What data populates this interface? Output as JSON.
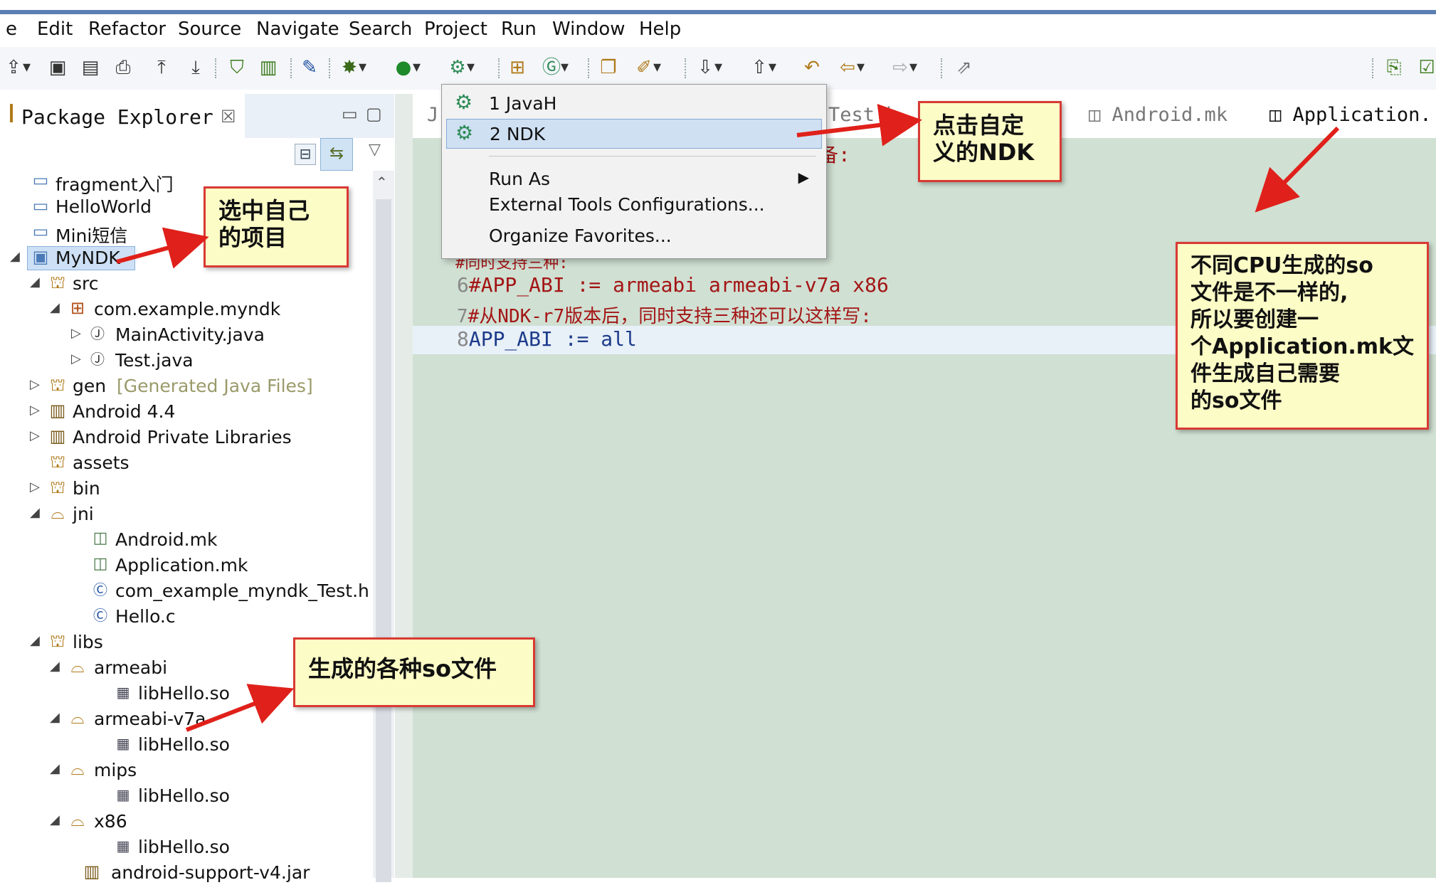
{
  "menubar": {
    "items": [
      "e",
      "Edit",
      "Refactor",
      "Source",
      "Navigate",
      "Search",
      "Project",
      "Run",
      "Window",
      "Help"
    ]
  },
  "toolbar": {
    "icons": [
      "new-icon",
      "save-icon",
      "save-all-icon",
      "print-icon",
      "upload-icon",
      "download-icon",
      "android-sdk-icon",
      "avd-icon",
      "debug-pointer-icon",
      "debug-icon",
      "run-icon",
      "external-tools-icon",
      "open-type-icon",
      "new-class-icon",
      "open-folder-icon",
      "pencil-icon",
      "next-annotation-icon",
      "prev-annotation-icon",
      "back-icon",
      "forward-icon",
      "last-edit-icon",
      "perspective-icon"
    ]
  },
  "package_explorer": {
    "title": "Package Explorer",
    "close_glyph": "☒",
    "tree": [
      {
        "label": "fragment入门",
        "icon": "folder-icon"
      },
      {
        "label": "HelloWorld",
        "icon": "folder-icon"
      },
      {
        "label": "Mini短信",
        "icon": "folder-icon"
      },
      {
        "label": "MyNDK",
        "icon": "project-icon",
        "selected": true
      },
      {
        "label": "src",
        "icon": "source-folder-icon"
      },
      {
        "label": "com.example.myndk",
        "icon": "package-icon"
      },
      {
        "label": "MainActivity.java",
        "icon": "java-file-icon"
      },
      {
        "label": "Test.java",
        "icon": "java-file-icon"
      },
      {
        "label": "gen",
        "decorator": "[Generated Java Files]",
        "icon": "source-folder-icon"
      },
      {
        "label": "Android 4.4",
        "icon": "library-icon"
      },
      {
        "label": "Android Private Libraries",
        "icon": "library-icon"
      },
      {
        "label": "assets",
        "icon": "folder-icon"
      },
      {
        "label": "bin",
        "icon": "folder-icon"
      },
      {
        "label": "jni",
        "icon": "folder-icon"
      },
      {
        "label": "Android.mk",
        "icon": "mk-file-icon"
      },
      {
        "label": "Application.mk",
        "icon": "mk-file-icon"
      },
      {
        "label": "com_example_myndk_Test.h",
        "icon": "c-file-icon"
      },
      {
        "label": "Hello.c",
        "icon": "c-file-icon"
      },
      {
        "label": "libs",
        "icon": "folder-icon"
      },
      {
        "label": "armeabi",
        "icon": "folder-icon"
      },
      {
        "label": "libHello.so",
        "icon": "binary-file-icon"
      },
      {
        "label": "armeabi-v7a",
        "icon": "folder-icon"
      },
      {
        "label": "libHello.so",
        "icon": "binary-file-icon"
      },
      {
        "label": "mips",
        "icon": "folder-icon"
      },
      {
        "label": "libHello.so",
        "icon": "binary-file-icon"
      },
      {
        "label": "x86",
        "icon": "folder-icon"
      },
      {
        "label": "libHello.so",
        "icon": "binary-file-icon"
      },
      {
        "label": "android-support-v4.jar",
        "icon": "jar-icon"
      }
    ]
  },
  "editor": {
    "tabs": [
      "Test.h",
      "Android.mk",
      "Application."
    ],
    "partial_text": "备:",
    "partial_comment": "#同时支持三种:",
    "lines": [
      {
        "num": "6",
        "text": "#APP_ABI := armeabi armeabi-v7a x86"
      },
      {
        "num": "7",
        "text": "#从NDK-r7版本后，同时支持三种还可以这样写:"
      },
      {
        "num": "8",
        "text": "APP_ABI := all"
      }
    ]
  },
  "dropdown": {
    "items": [
      "1 JavaH",
      "2 NDK",
      "Run As",
      "External Tools Configurations...",
      "Organize Favorites..."
    ]
  },
  "callouts": {
    "select_project": "选中自己\n的项目",
    "click_ndk": "点击自定\n义的NDK",
    "so_files": "生成的各种so文件",
    "application_mk": "不同CPU生成的so\n文件是不一样的,\n所以要创建一\n个Application.mk文\n件生成自己需要\n的so文件"
  },
  "colors": {
    "editor_bg": "#d0e0d3",
    "callout_bg": "#fcfcc6",
    "callout_border": "#d83a34",
    "arrow": "#e0201a",
    "selection": "#cde0f5"
  }
}
